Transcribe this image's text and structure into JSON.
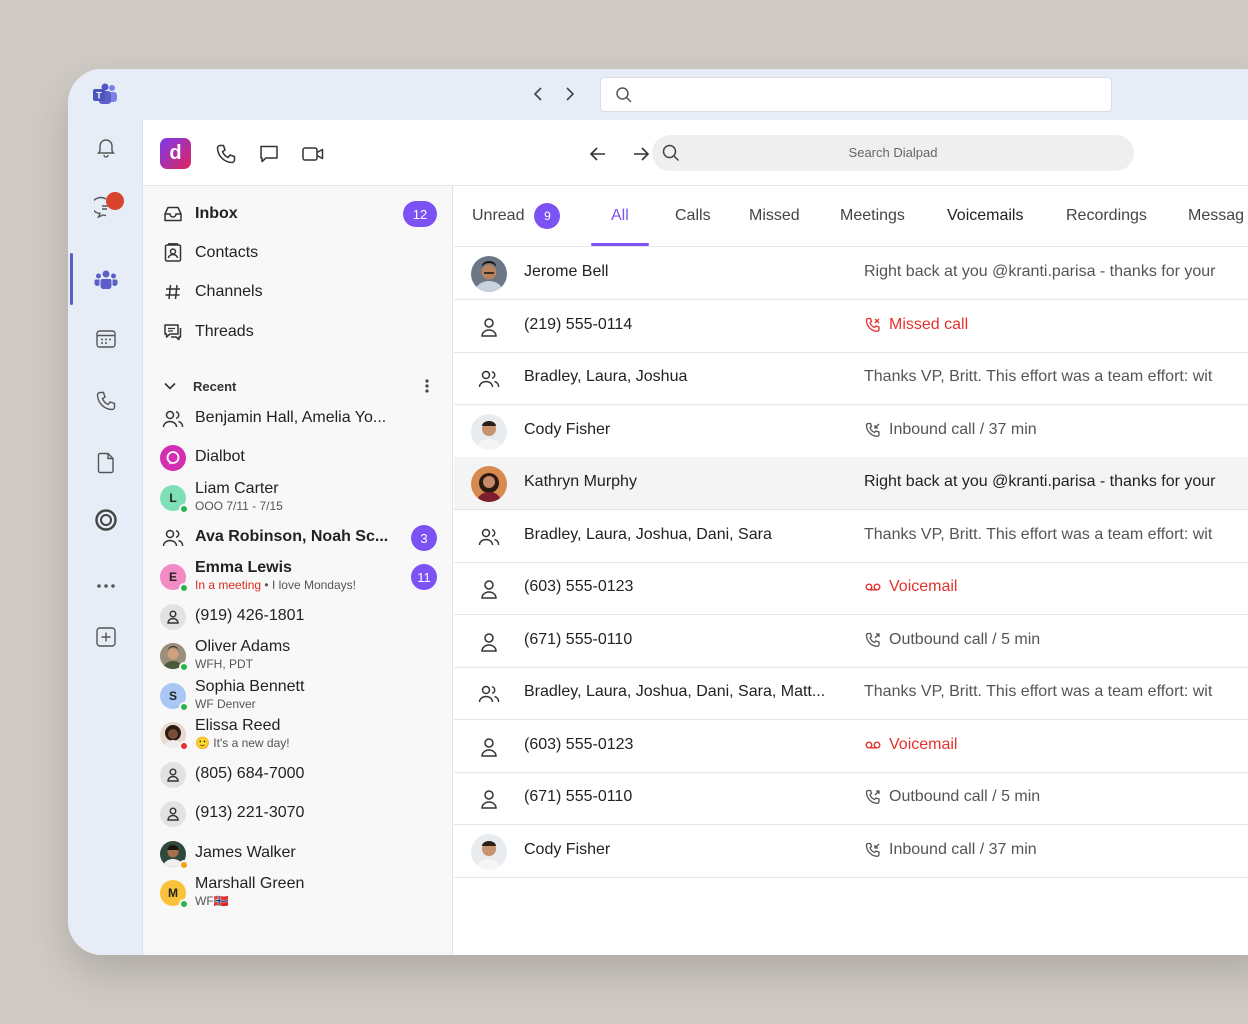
{
  "teams": {
    "top_search": {
      "placeholder": ""
    },
    "rail": [
      {
        "name": "activity",
        "icon": "bell-icon"
      },
      {
        "name": "chat",
        "icon": "chat-icon",
        "badge": true
      },
      {
        "name": "teams",
        "icon": "teams-icon",
        "active": true
      },
      {
        "name": "calendar",
        "icon": "calendar-icon"
      },
      {
        "name": "calls",
        "icon": "phone-icon"
      },
      {
        "name": "files",
        "icon": "file-icon"
      },
      {
        "name": "dialpad-app",
        "icon": "app-ring-icon"
      },
      {
        "name": "more",
        "icon": "more-icon"
      },
      {
        "name": "add-app",
        "icon": "add-icon"
      }
    ]
  },
  "dialpad": {
    "logo_letter": "d",
    "search_placeholder": "Search Dialpad"
  },
  "sidebar": {
    "nav": [
      {
        "label": "Inbox",
        "icon": "inbox-icon",
        "badge": "12",
        "bold": true
      },
      {
        "label": "Contacts",
        "icon": "contacts-icon"
      },
      {
        "label": "Channels",
        "icon": "hash-icon"
      },
      {
        "label": "Threads",
        "icon": "threads-icon"
      }
    ],
    "recent_label": "Recent",
    "recent": [
      {
        "name": "Benjamin Hall, Amelia Yo..."
      },
      {
        "name": "Dialbot"
      },
      {
        "name": "Liam Carter",
        "sub": "OOO 7/11 - 7/15",
        "initial": "L"
      },
      {
        "name": "Ava Robinson, Noah Sc...",
        "badge": "3"
      },
      {
        "name": "Emma Lewis",
        "sub_status": "In a meeting",
        "sub_sep": "•",
        "sub": "I love Mondays!",
        "badge": "11",
        "initial": "E"
      },
      {
        "name": "(919) 426-1801"
      },
      {
        "name": "Oliver Adams",
        "sub": "WFH, PDT"
      },
      {
        "name": "Sophia Bennett",
        "sub": "WF Denver",
        "initial": "S"
      },
      {
        "name": "Elissa Reed",
        "sub": "🙂 It's a new day!"
      },
      {
        "name": "(805) 684-7000"
      },
      {
        "name": "(913) 221-3070"
      },
      {
        "name": "James Walker"
      },
      {
        "name": "Marshall Green",
        "sub": "WF🇳🇴",
        "initial": "M"
      }
    ]
  },
  "tabs": [
    {
      "label": "Unread",
      "badge": "9"
    },
    {
      "label": "All",
      "active": true
    },
    {
      "label": "Calls"
    },
    {
      "label": "Missed"
    },
    {
      "label": "Meetings"
    },
    {
      "label": "Voicemails"
    },
    {
      "label": "Recordings"
    },
    {
      "label": "Messag"
    }
  ],
  "rows": [
    {
      "name": "Jerome Bell",
      "message": "Right back at you @kranti.parisa - thanks for your"
    },
    {
      "name": "(219) 555-0114",
      "message": "Missed call"
    },
    {
      "name": "Bradley, Laura, Joshua",
      "message": "Thanks VP, Britt. This effort was a team effort: wit"
    },
    {
      "name": "Cody Fisher",
      "message": "Inbound call / 37 min"
    },
    {
      "name": "Kathryn Murphy",
      "message": "Right back at you @kranti.parisa - thanks for your"
    },
    {
      "name": "Bradley, Laura, Joshua, Dani, Sara",
      "message": "Thanks VP, Britt. This effort was a team effort: wit"
    },
    {
      "name": "(603) 555-0123",
      "message": "Voicemail"
    },
    {
      "name": "(671) 555-0110",
      "message": "Outbound call / 5 min"
    },
    {
      "name": "Bradley, Laura, Joshua, Dani, Sara, Matt...",
      "message": "Thanks VP, Britt. This effort was a team effort: wit"
    },
    {
      "name": "(603) 555-0123",
      "message": "Voicemail"
    },
    {
      "name": "(671) 555-0110",
      "message": "Outbound call / 5 min"
    },
    {
      "name": "Cody Fisher",
      "message": "Inbound call / 37 min"
    }
  ],
  "colors": {
    "accent": "#7c52f5",
    "missed": "#e5322d",
    "teams_rail": "#e7edf6"
  }
}
